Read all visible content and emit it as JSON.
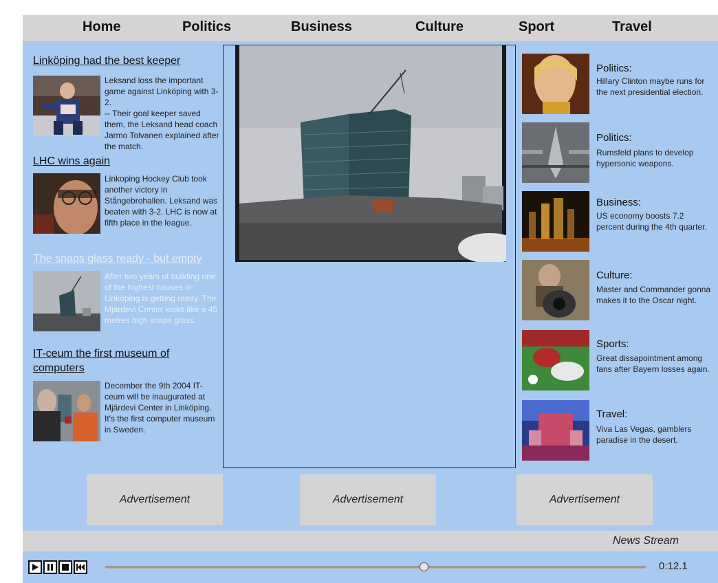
{
  "nav": [
    "Home",
    "Politics",
    "Business",
    "Culture",
    "Sport",
    "Travel"
  ],
  "left_stories": [
    {
      "title": "Linköping had the best keeper",
      "body": "Leksand loss the important game against Linköping with 3-2.\n-- Their goal keeper saved them, the Leksand head coach Jarmo Tolvanen explained after the match."
    },
    {
      "title": "LHC wins again",
      "body": "Linkoping Hockey Club took another victory in Stångebrohallen. Leksand was beaten with 3-2. LHC is now at fifth place in the league."
    },
    {
      "title": "The snaps glass ready - but empty",
      "body": "After two years of building one of the highest houses in Linköping is getting ready. The Mjärdevi Center looks like a 45 metres high snaps glass."
    },
    {
      "title": "IT-ceum the first museum of computers",
      "body": "December the 9th 2004 IT-ceum will be inaugurated at Mjärdevi Center in Linköping. It's the first computer museum in Sweden."
    }
  ],
  "right_stories": [
    {
      "category": "Politics:",
      "text": "Hillary Clinton maybe runs for the next presidential election."
    },
    {
      "category": "Politics:",
      "text": "Rumsfeld plans to develop hypersonic weapons."
    },
    {
      "category": "Business:",
      "text": "US economy boosts 7.2 percent during the 4th quarter."
    },
    {
      "category": "Culture:",
      "text": "Master and Commander gonna makes it to the Oscar night."
    },
    {
      "category": "Sports:",
      "text": "Great dissapointment among fans after Bayern losses again."
    },
    {
      "category": "Travel:",
      "text": "Viva Las Vegas, gamblers paradise in the desert."
    }
  ],
  "ads": [
    "Advertisement",
    "Advertisement",
    "Advertisement"
  ],
  "news_stream": "News Stream",
  "player": {
    "time": "0:12.1",
    "progress_fraction": 0.59,
    "controls": [
      "play-icon",
      "pause-icon",
      "stop-icon",
      "rewind-icon"
    ]
  },
  "colors": {
    "background": "#a8c9f0",
    "bars": "#d4d4d4",
    "faded_text": "#e6eefb"
  }
}
